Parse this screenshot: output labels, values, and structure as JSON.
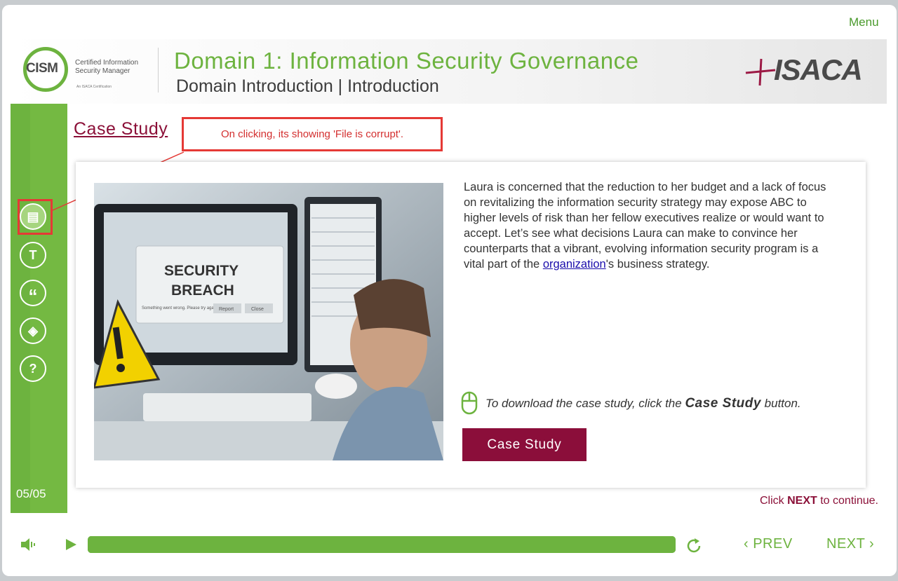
{
  "menu": {
    "label": "Menu"
  },
  "header": {
    "cism_logo_text": "CISM",
    "cism_logo_sub_line1": "Certified Information",
    "cism_logo_sub_line2": "Security Manager",
    "cism_logo_small": "An ISACA Certification",
    "title": "Domain 1: Information Security Governance",
    "subtitle": "Domain Introduction | Introduction",
    "isaca_logo_text": "ISACA"
  },
  "sidebar": {
    "items": [
      {
        "icon": "document-icon",
        "glyph": "▤"
      },
      {
        "icon": "transcript-icon",
        "glyph": "T"
      },
      {
        "icon": "quote-icon",
        "glyph": "“"
      },
      {
        "icon": "layers-icon",
        "glyph": "◈"
      },
      {
        "icon": "help-icon",
        "glyph": "?"
      }
    ],
    "page_count": "05/05"
  },
  "main": {
    "title": "Case Study",
    "callout": "On clicking, its showing 'File is corrupt'.",
    "photo_caption_1": "SECURITY",
    "photo_caption_2": "BREACH",
    "photo_small_text": "Something went wrong. Please try again.",
    "photo_btn_report": "Report",
    "photo_btn_close": "Close",
    "body_before_link": "Laura is concerned that the reduction to her budget and a lack of focus on revitalizing the information security strategy may expose ABC to higher levels of risk than her fellow executives realize or would want to accept. Let’s see what decisions Laura can make to convince her counterparts that a vibrant, evolving information security program is a vital part of the ",
    "body_link": "organization",
    "body_after_link": "'s business strategy.",
    "download_prefix": "To download the case study, click the ",
    "download_bold": "Case Study",
    "download_suffix": " button.",
    "case_study_button": "Case Study",
    "next_hint_prefix": "Click ",
    "next_hint_bold": "NEXT",
    "next_hint_suffix": " to continue."
  },
  "footer": {
    "progress": 1.0,
    "prev_label": "PREV",
    "next_label": "NEXT"
  },
  "colors": {
    "accent_green": "#6db33f",
    "maroon": "#8b0e3a",
    "callout_red": "#e53935"
  }
}
